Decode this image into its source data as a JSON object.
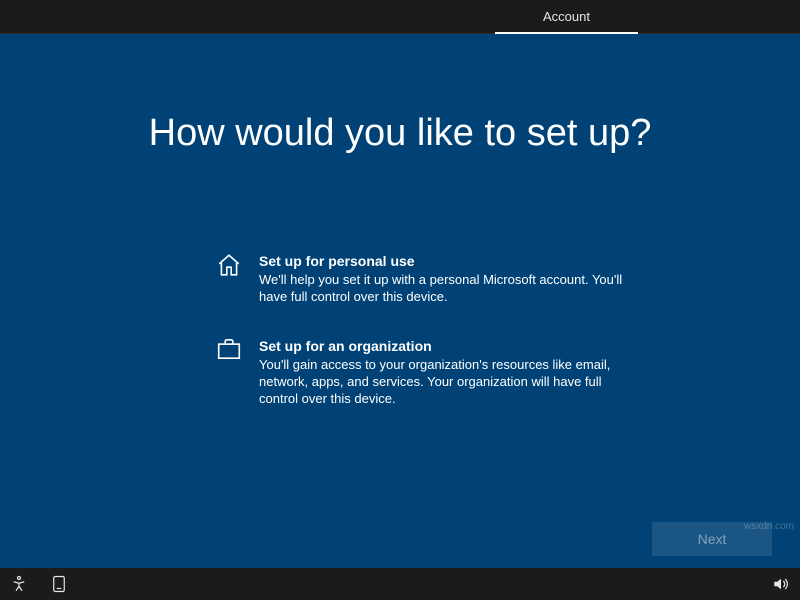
{
  "topbar": {
    "active_tab": "Account"
  },
  "heading": "How would you like to set up?",
  "options": [
    {
      "icon": "home-icon",
      "title": "Set up for personal use",
      "desc": "We'll help you set it up with a personal Microsoft account. You'll have full control over this device."
    },
    {
      "icon": "briefcase-icon",
      "title": "Set up for an organization",
      "desc": "You'll gain access to your organization's resources like email, network, apps, and services. Your organization will have full control over this device."
    }
  ],
  "next_button": "Next",
  "watermark": "wsxdn.com",
  "colors": {
    "background": "#004275",
    "bar": "#1b1b1b",
    "text": "#ffffff"
  }
}
